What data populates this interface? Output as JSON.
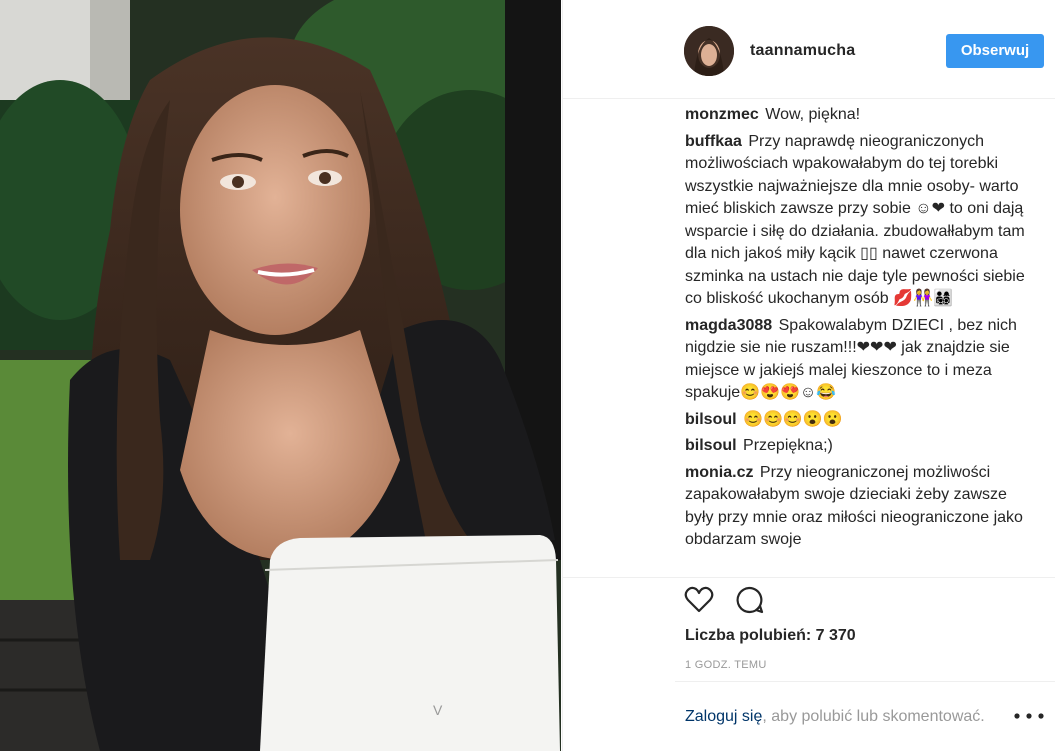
{
  "post": {
    "username": "taannamucha",
    "follow_label": "Obserwuj",
    "likes_text": "Liczba polubień: 7 370",
    "time_text": "1 GODZ. TEMU",
    "login_link": "Zaloguj się",
    "login_rest": ", aby polubić lub skomentować."
  },
  "comments": [
    {
      "user": "monzmec",
      "text": "Wow, piękna!"
    },
    {
      "user": "buffkaa",
      "text": "Przy naprawdę nieograniczonych możliwościach wpakowałabym do tej torebki wszystkie najważniejsze dla mnie osoby- warto mieć bliskich zawsze przy sobie ☺❤ to oni dają wsparcie i siłę do działania. zbudowałłabym tam dla nich jakoś miły kącik ▯▯ nawet czerwona szminka na ustach nie daje tyle pewności siebie co bliskość ukochanym osób 💋👭👨‍👩‍👧‍👦"
    },
    {
      "user": "magda3088",
      "text": "Spakowalabym DZIECI , bez nich nigdzie sie nie ruszam!!!❤❤❤ jak znajdzie sie miejsce w jakiejś malej kieszonce to i meza spakuje😊😍😍☺😂"
    },
    {
      "user": "bilsoul",
      "text": "😊😊😊😮😮"
    },
    {
      "user": "bilsoul",
      "text": "Przepiękna;)"
    },
    {
      "user": "monia.cz",
      "text": "Przy nieograniczonej możliwości zapakowałabym swoje dzieciaki żeby zawsze były przy mnie oraz miłości nieograniczone jako obdarzam swoje"
    }
  ],
  "icons": {
    "like": "heart-icon",
    "comment": "comment-icon",
    "more": "more-options-icon"
  },
  "colors": {
    "accent": "#3897f0",
    "link": "#003569",
    "muted": "#999999"
  }
}
